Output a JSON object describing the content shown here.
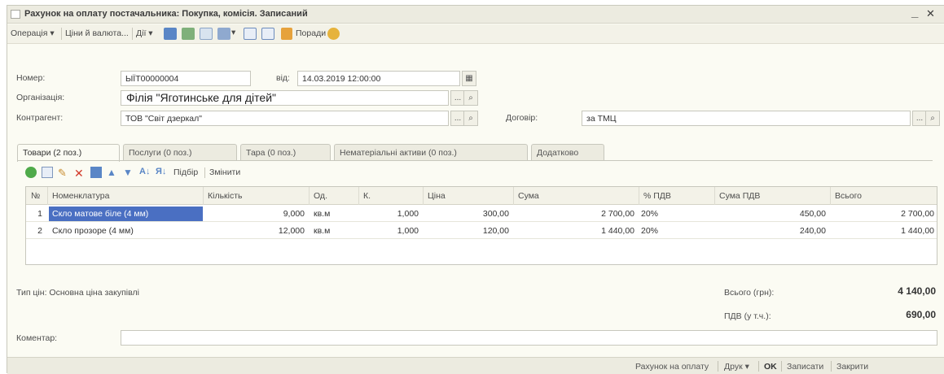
{
  "window": {
    "title": "Рахунок на оплату постачальника: Покупка, комісія. Записаний",
    "minimize": "_",
    "close": "✕"
  },
  "toolbar": {
    "operation": "Операція ▾",
    "prices_currency": "Ціни й валюта...",
    "actions": "Дії ▾",
    "hints": "Поради"
  },
  "header": {
    "number_label": "Номер:",
    "number_value": "ЫЇТ00000004",
    "from_label": "від:",
    "date_value": "14.03.2019 12:00:00",
    "org_label": "Організація:",
    "org_value": "Філія \"Яготинське для дітей\"",
    "contractor_label": "Контрагент:",
    "contractor_value": "ТОВ \"Світ дзеркал\"",
    "contract_label": "Договір:",
    "contract_value": "за ТМЦ"
  },
  "tabs": [
    {
      "label": "Товари (2 поз.)"
    },
    {
      "label": "Послуги (0 поз.)"
    },
    {
      "label": "Тара (0 поз.)"
    },
    {
      "label": "Нематеріальні активи (0 поз.)"
    },
    {
      "label": "Додатково"
    }
  ],
  "grid_toolbar": {
    "pick": "Підбір",
    "change": "Змінити"
  },
  "table": {
    "columns": [
      "№",
      "Номенклатура",
      "Кількість",
      "Од.",
      "К.",
      "Ціна",
      "Сума",
      "% ПДВ",
      "Сума ПДВ",
      "Всього"
    ],
    "rows": [
      {
        "n": "1",
        "item": "Скло матове біле (4 мм)",
        "qty": "9,000",
        "unit": "кв.м",
        "k": "1,000",
        "price": "300,00",
        "sum": "2 700,00",
        "vat_rate": "20%",
        "vat_sum": "450,00",
        "total": "2 700,00"
      },
      {
        "n": "2",
        "item": "Скло прозоре (4 мм)",
        "qty": "12,000",
        "unit": "кв.м",
        "k": "1,000",
        "price": "120,00",
        "sum": "1 440,00",
        "vat_rate": "20%",
        "vat_sum": "240,00",
        "total": "1 440,00"
      }
    ]
  },
  "footer": {
    "price_type": "Тип цін: Основна ціна закупівлі",
    "total_label": "Всього (грн):",
    "total_value": "4 140,00",
    "vat_label": "ПДВ (у т.ч.):",
    "vat_value": "690,00",
    "comment_label": "Коментар:"
  },
  "bottombar": {
    "invoice": "Рахунок на оплату",
    "print": "Друк ▾",
    "ok": "OK",
    "save": "Записати",
    "close": "Закрити"
  }
}
